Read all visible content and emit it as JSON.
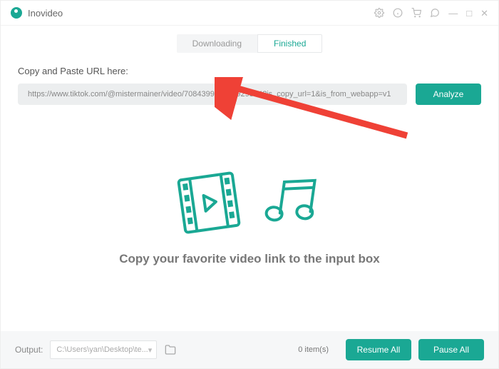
{
  "app": {
    "title": "Inovideo"
  },
  "titlebar_icons": [
    "settings",
    "info",
    "cart",
    "help",
    "minimize",
    "maximize",
    "close"
  ],
  "tabs": {
    "downloading": "Downloading",
    "finished": "Finished",
    "active": "finished"
  },
  "url": {
    "label": "Copy and Paste URL here:",
    "value": "https://www.tiktok.com/@mistermainer/video/708439978809929334?is_copy_url=1&is_from_webapp=v1",
    "analyze": "Analyze"
  },
  "center": {
    "message": "Copy your favorite video link to the input box"
  },
  "footer": {
    "output_label": "Output:",
    "output_path": "C:\\Users\\yan\\Desktop\\te...",
    "items": "0 item(s)",
    "resume": "Resume All",
    "pause": "Pause All"
  },
  "colors": {
    "accent": "#1aa894",
    "arrow": "#ef4136"
  }
}
